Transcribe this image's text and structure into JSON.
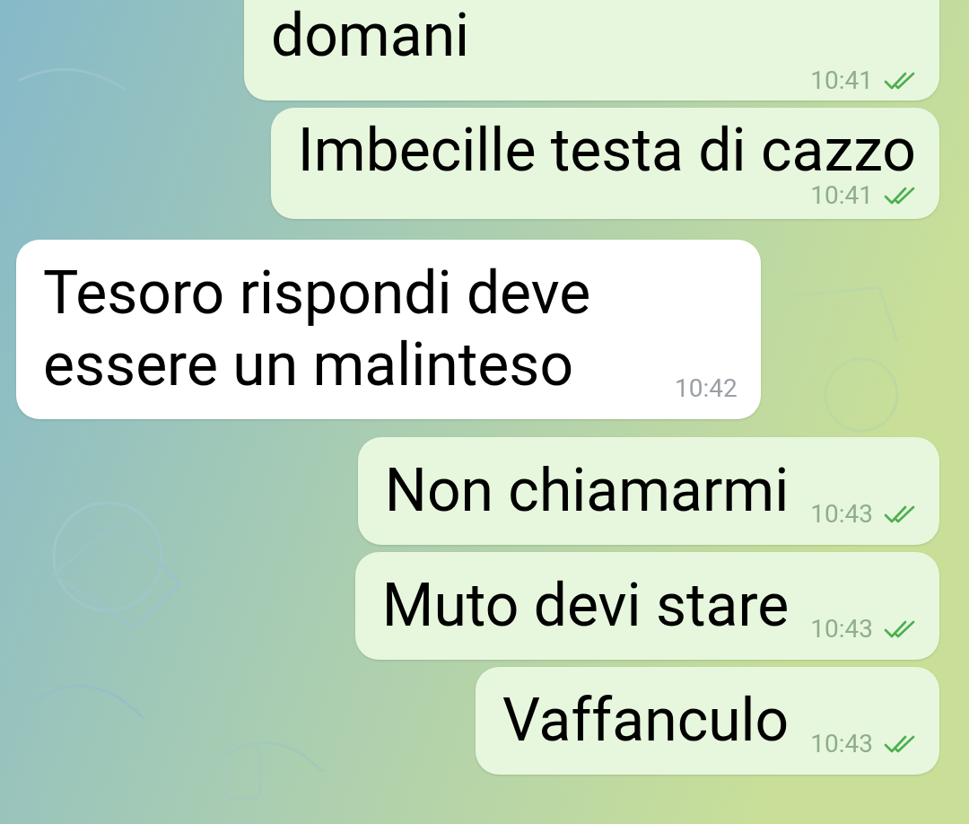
{
  "messages": [
    {
      "outgoing": true,
      "kind": "stacked",
      "text": "domani",
      "time": "10:41",
      "read": true,
      "cut_top": true
    },
    {
      "outgoing": true,
      "kind": "stacked",
      "text": "Imbecille testa di cazzo",
      "time": "10:41",
      "read": true,
      "cut_top": false
    },
    {
      "outgoing": false,
      "kind": "inline",
      "text": "Tesoro rispondi deve essere un malinteso",
      "time": "10:42",
      "cut_top": false
    },
    {
      "outgoing": true,
      "kind": "inline",
      "text": "Non chiamarmi",
      "time": "10:43",
      "read": true,
      "cut_top": false
    },
    {
      "outgoing": true,
      "kind": "inline",
      "text": "Muto devi stare",
      "time": "10:43",
      "read": true,
      "cut_top": false
    },
    {
      "outgoing": true,
      "kind": "inline",
      "text": "Vaffanculo",
      "time": "10:43",
      "read": true,
      "cut_top": false
    }
  ]
}
